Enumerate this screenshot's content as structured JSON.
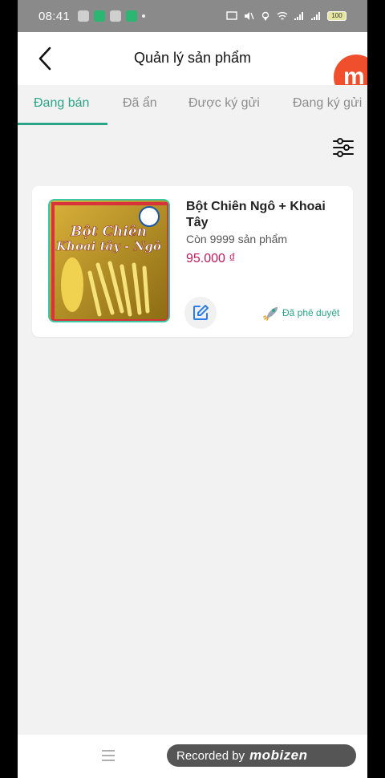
{
  "status_bar": {
    "time": "08:41",
    "battery": "100",
    "left_icons": [
      "notification-icon",
      "message-icon",
      "app-icon",
      "shield-icon"
    ],
    "right_icons": [
      "cast-icon",
      "mute-icon",
      "location-icon",
      "wifi-icon",
      "signal-icon",
      "signal-icon",
      "battery-icon"
    ]
  },
  "header": {
    "title": "Quản lý sản phẩm",
    "badge_letter": "m"
  },
  "tabs": [
    {
      "label": "Đang bán",
      "active": true
    },
    {
      "label": "Đã ẩn",
      "active": false
    },
    {
      "label": "Được ký gửi",
      "active": false
    },
    {
      "label": "Đang ký gửi",
      "active": false
    }
  ],
  "colors": {
    "accent": "#2aa585",
    "price": "#c2185b",
    "mobizen": "#f04f2e"
  },
  "products": [
    {
      "name": "Bột Chiên Ngô + Khoai Tây",
      "stock": "Còn 9999 sản phẩm",
      "price": "95.000 ₫",
      "status": "Đã phê duyệt",
      "image_text": {
        "line1": "Bột Chiên",
        "line2": "Khoai tây - Ngô"
      }
    }
  ],
  "recording": {
    "label": "Recorded by",
    "brand": "mobizen"
  }
}
